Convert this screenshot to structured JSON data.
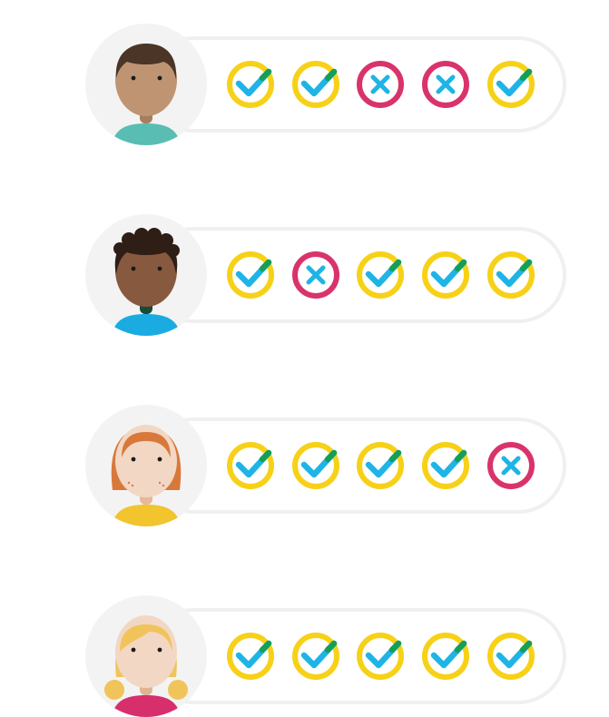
{
  "colors": {
    "pill_border": "#f0f0f0",
    "avatar_bg": "#f3f3f3",
    "pass_ring": "#f7d117",
    "pass_check": "#1fb4e6",
    "pass_check_tip": "#149e5a",
    "fail_ring": "#d9336c",
    "fail_x": "#1fb4e6"
  },
  "rows": [
    {
      "avatar": {
        "icon": "person-short-dark-hair-icon",
        "skin": "#bf9472",
        "hair": "#4a3526",
        "shirt": "#59bdb3",
        "neck": "#a67d5e",
        "style": "short"
      },
      "results": [
        "pass",
        "pass",
        "fail",
        "fail",
        "pass"
      ]
    },
    {
      "avatar": {
        "icon": "person-curly-hair-icon",
        "skin": "#87593e",
        "hair": "#2e1e16",
        "shirt": "#1aace1",
        "neck": "#1b4a36",
        "style": "curly"
      },
      "results": [
        "pass",
        "fail",
        "pass",
        "pass",
        "pass"
      ]
    },
    {
      "avatar": {
        "icon": "person-red-hair-freckles-icon",
        "skin": "#f2d7c4",
        "hair": "#d9783b",
        "shirt": "#f2c42d",
        "neck": "#e8b89a",
        "style": "bob"
      },
      "results": [
        "pass",
        "pass",
        "pass",
        "pass",
        "fail"
      ]
    },
    {
      "avatar": {
        "icon": "person-blonde-pigtails-icon",
        "skin": "#f2d7c4",
        "hair": "#f0c45a",
        "shirt": "#d62f6c",
        "neck": "#e0b393",
        "style": "pigtails"
      },
      "results": [
        "pass",
        "pass",
        "pass",
        "pass",
        "pass"
      ]
    }
  ]
}
